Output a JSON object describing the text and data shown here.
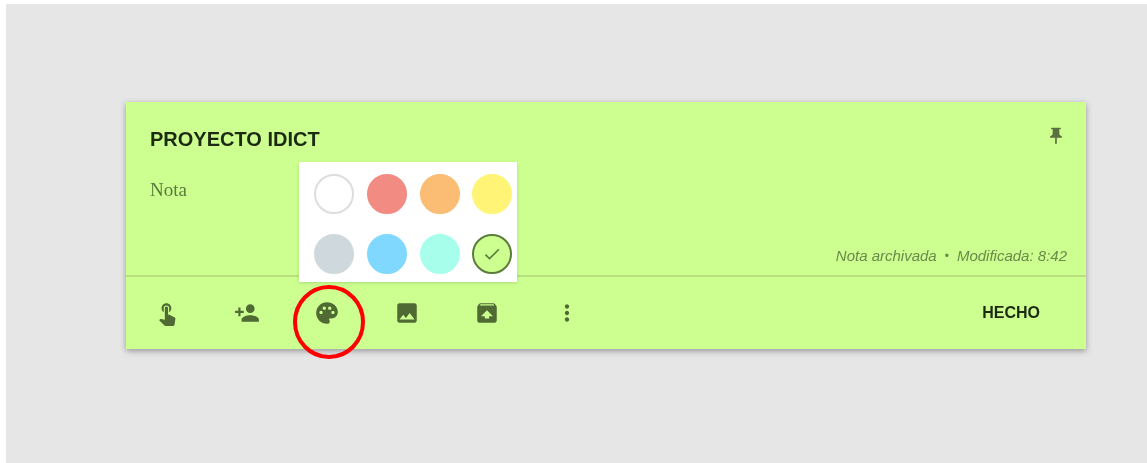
{
  "note": {
    "title": "PROYECTO IDICT",
    "body": "Nota",
    "status": [
      "Nota archivada",
      "Modificada: 8:42"
    ],
    "separator": "•"
  },
  "palette": {
    "colors": [
      {
        "color": "#ffffff",
        "selected": false
      },
      {
        "color": "#f28b82",
        "selected": false
      },
      {
        "color": "#fbbc74",
        "selected": false
      },
      {
        "color": "#fff475",
        "selected": false
      },
      {
        "color": "#cfd8dc",
        "selected": false
      },
      {
        "color": "#80d8ff",
        "selected": false
      },
      {
        "color": "#a7ffeb",
        "selected": false
      },
      {
        "color": "#ccff90",
        "selected": true
      }
    ]
  },
  "done_button": "HECHO"
}
